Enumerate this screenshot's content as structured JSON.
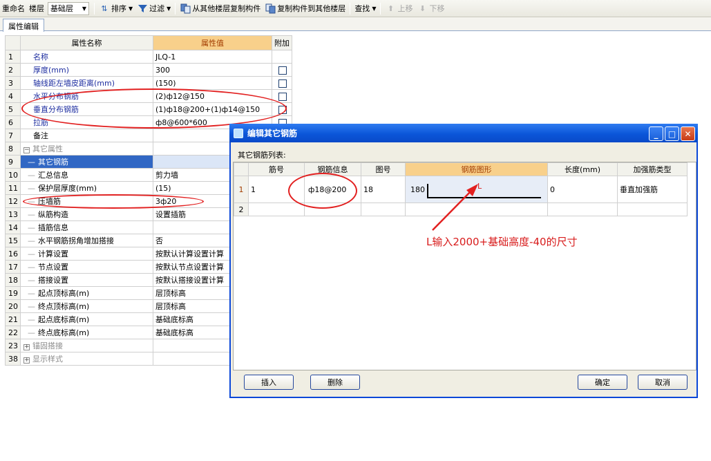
{
  "toolbar": {
    "rename": "重命名",
    "floor_label": "楼层",
    "floor_value": "基础层",
    "sort": "排序",
    "filter": "过滤",
    "copy_from": "从其他楼层复制构件",
    "copy_to": "复制构件到其他楼层",
    "find": "查找",
    "move_up": "上移",
    "move_down": "下移"
  },
  "tabs": {
    "active": "属性编辑"
  },
  "grid": {
    "headers": {
      "name": "属性名称",
      "value": "属性值",
      "extra": "附加"
    },
    "rows": [
      {
        "n": "1",
        "name": "名称",
        "value": "JLQ-1"
      },
      {
        "n": "2",
        "name": "厚度(mm)",
        "value": "300"
      },
      {
        "n": "3",
        "name": "轴线距左墙皮距离(mm)",
        "value": "(150)"
      },
      {
        "n": "4",
        "name": "水平分布钢筋",
        "value": "(2)ф12@150"
      },
      {
        "n": "5",
        "name": "垂直分布钢筋",
        "value": "(1)ф18@200+(1)ф14@150"
      },
      {
        "n": "6",
        "name": "拉筋",
        "value": "ф8@600*600"
      },
      {
        "n": "7",
        "name": "备注",
        "value": ""
      },
      {
        "n": "8",
        "name": "其它属性",
        "value": ""
      },
      {
        "n": "9",
        "name": "其它钢筋",
        "value": ""
      },
      {
        "n": "10",
        "name": "汇总信息",
        "value": "剪力墙"
      },
      {
        "n": "11",
        "name": "保护层厚度(mm)",
        "value": "(15)"
      },
      {
        "n": "12",
        "name": "压墙筋",
        "value": "3ф20"
      },
      {
        "n": "13",
        "name": "纵筋构造",
        "value": "设置插筋"
      },
      {
        "n": "14",
        "name": "插筋信息",
        "value": ""
      },
      {
        "n": "15",
        "name": "水平钢筋拐角增加搭接",
        "value": "否"
      },
      {
        "n": "16",
        "name": "计算设置",
        "value": "按默认计算设置计算"
      },
      {
        "n": "17",
        "name": "节点设置",
        "value": "按默认节点设置计算"
      },
      {
        "n": "18",
        "name": "搭接设置",
        "value": "按默认搭接设置计算"
      },
      {
        "n": "19",
        "name": "起点顶标高(m)",
        "value": "层顶标高"
      },
      {
        "n": "20",
        "name": "终点顶标高(m)",
        "value": "层顶标高"
      },
      {
        "n": "21",
        "name": "起点底标高(m)",
        "value": "基础底标高"
      },
      {
        "n": "22",
        "name": "终点底标高(m)",
        "value": "基础底标高"
      },
      {
        "n": "23",
        "name": "锚固搭接",
        "value": ""
      },
      {
        "n": "38",
        "name": "显示样式",
        "value": ""
      }
    ]
  },
  "dialog": {
    "title": "编辑其它钢筋",
    "list_label": "其它钢筋列表:",
    "headers": [
      "筋号",
      "钢筋信息",
      "图号",
      "钢筋图形",
      "长度(mm)",
      "加强筋类型"
    ],
    "rows": [
      {
        "n": "1",
        "bar_no": "1",
        "bar_info": "ф18@200",
        "fig_no": "18",
        "shape_left": "180",
        "shape_l": "L",
        "length": "0",
        "type": "垂直加强筋"
      },
      {
        "n": "2",
        "bar_no": "",
        "bar_info": "",
        "fig_no": "",
        "shape_left": "",
        "shape_l": "",
        "length": "",
        "type": ""
      }
    ],
    "buttons": {
      "insert": "插入",
      "delete": "删除",
      "ok": "确定",
      "cancel": "取消"
    }
  },
  "annotation": {
    "note": "L输入2000+基础高度-40的尺寸",
    "color": "#e22020"
  }
}
